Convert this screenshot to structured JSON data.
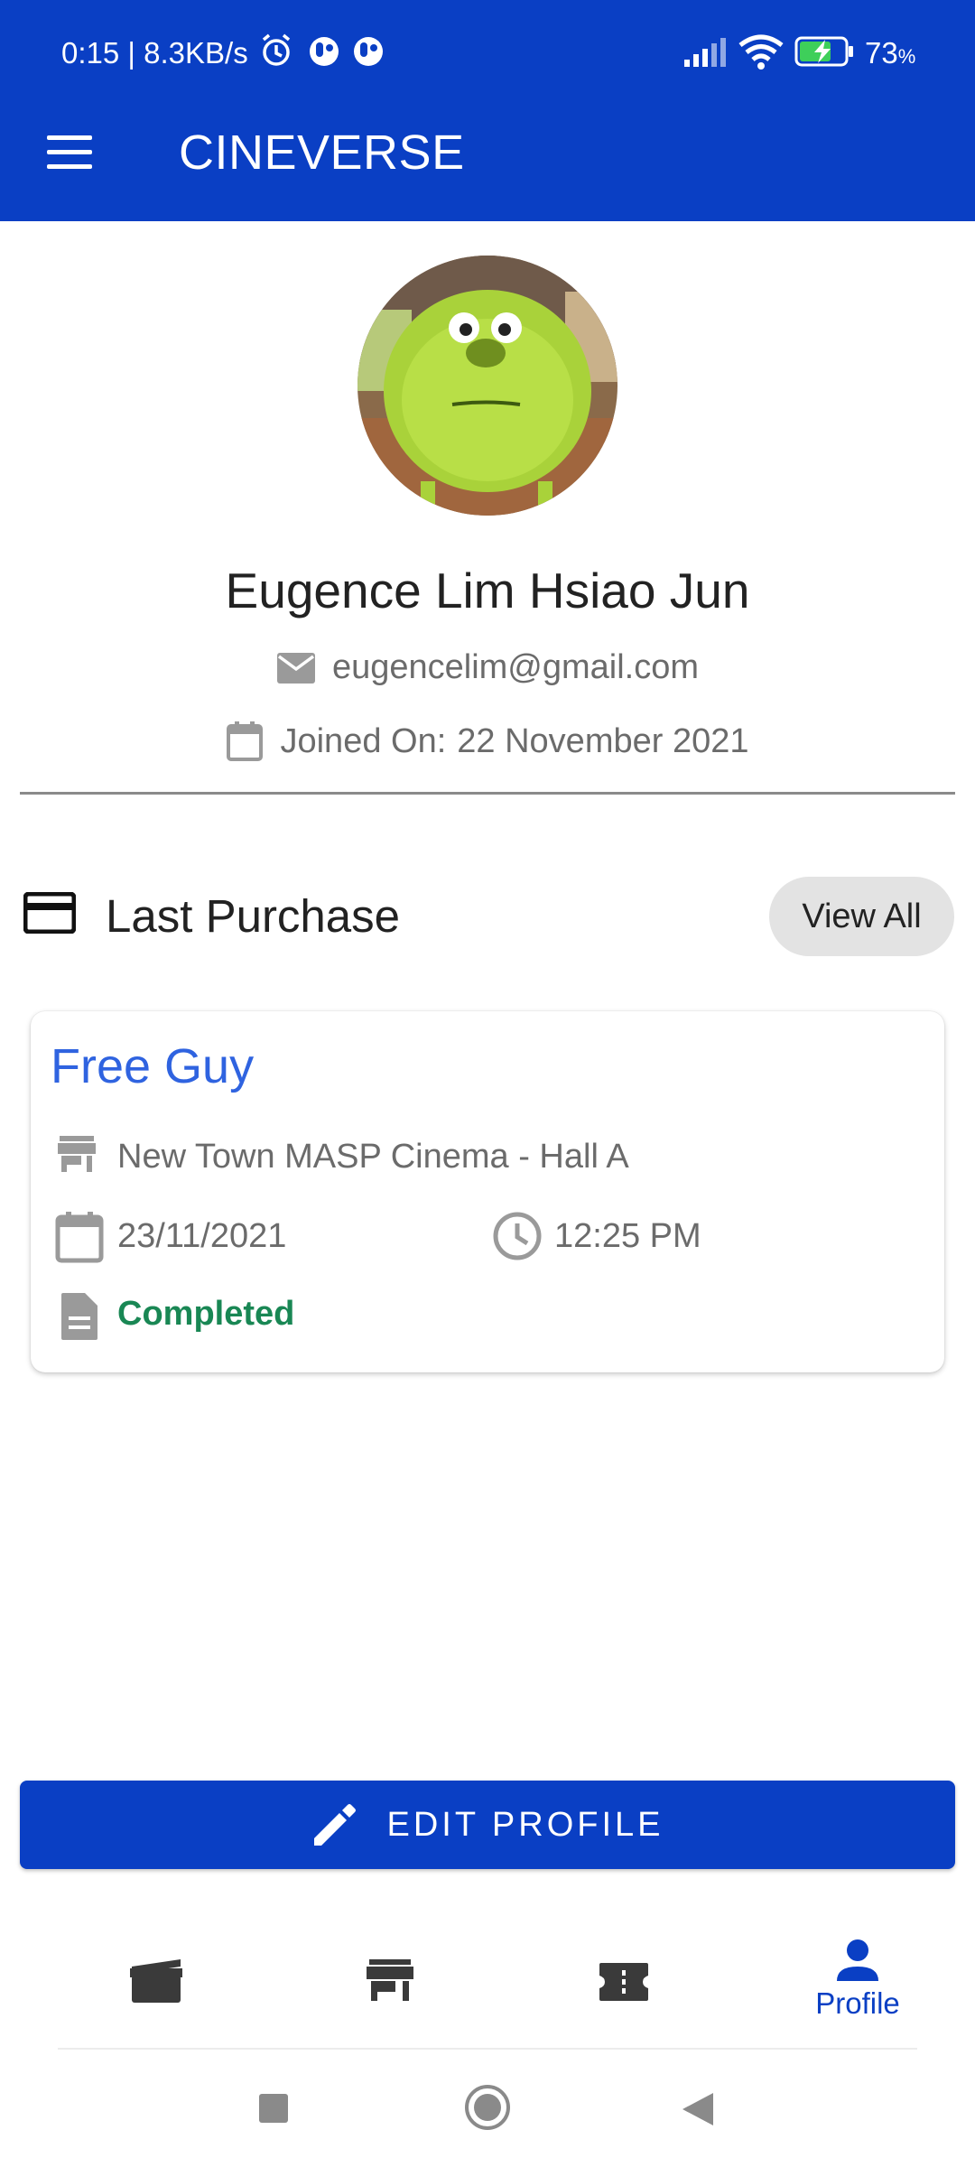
{
  "status_bar": {
    "time_speed": "0:15 | 8.3KB/s",
    "battery": "73",
    "battery_unit": "%"
  },
  "app_bar": {
    "title": "CINEVERSE",
    "menu_icon": "hamburger-menu-icon"
  },
  "profile": {
    "name": "Eugence Lim Hsiao Jun",
    "email": "eugencelim@gmail.com",
    "joined_label": "Joined On:",
    "joined_date": "22 November 2021"
  },
  "last_purchase": {
    "title": "Last Purchase",
    "view_all_label": "View All",
    "movie": "Free Guy",
    "cinema": "New Town MASP Cinema - Hall A",
    "date": "23/11/2021",
    "time": "12:25 PM",
    "status": "Completed"
  },
  "edit_profile_label": "EDIT PROFILE",
  "bottom_nav": {
    "items": [
      {
        "icon": "movie-clapper-icon",
        "label": ""
      },
      {
        "icon": "store-icon",
        "label": ""
      },
      {
        "icon": "ticket-icon",
        "label": ""
      },
      {
        "icon": "person-icon",
        "label": "Profile"
      }
    ]
  },
  "colors": {
    "primary": "#0a3fc4",
    "movie_title": "#2f63e0",
    "completed": "#198754"
  }
}
